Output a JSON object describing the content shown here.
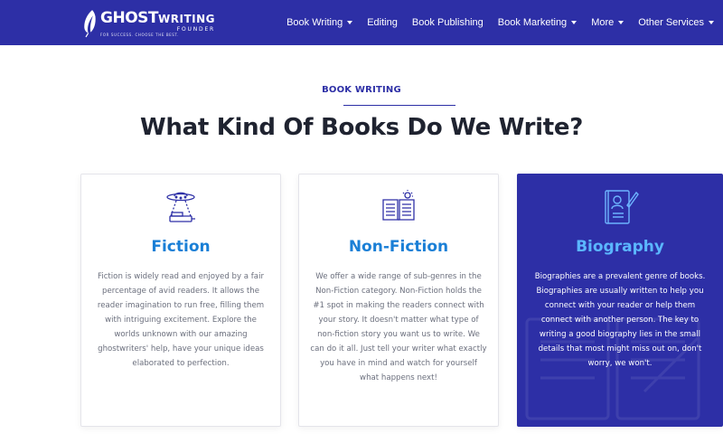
{
  "header": {
    "logo": {
      "main_text": "GHOST",
      "accent_text": "WRITING",
      "sub_text": "FOUNDER",
      "tagline": "FOR SUCCESS. CHOOSE THE BEST."
    },
    "nav": [
      {
        "label": "Book Writing",
        "has_dropdown": true
      },
      {
        "label": "Editing",
        "has_dropdown": false
      },
      {
        "label": "Book Publishing",
        "has_dropdown": false
      },
      {
        "label": "Book Marketing",
        "has_dropdown": true
      },
      {
        "label": "More",
        "has_dropdown": true
      },
      {
        "label": "Other Services",
        "has_dropdown": true
      }
    ]
  },
  "section": {
    "eyebrow": "BOOK WRITING",
    "heading": "What Kind Of Books Do We Write?"
  },
  "cards": [
    {
      "title": "Fiction",
      "icon": "ufo-book-icon",
      "body": "Fiction is widely read and enjoyed by a fair percentage of avid readers. It allows the reader imagination to run free, filling them with intriguing excitement. Explore the worlds unknown with our amazing ghostwriters' help, have your unique ideas elaborated to perfection."
    },
    {
      "title": "Non-Fiction",
      "icon": "open-book-icon",
      "body": "We offer a wide range of sub-genres in the Non-Fiction category. Non-Fiction holds the #1 spot in making the readers connect with your story. It doesn't matter what type of non-fiction story you want us to write. We can do it all. Just tell your writer what exactly you have in mind and watch for yourself what happens next!"
    },
    {
      "title": "Biography",
      "icon": "biography-book-icon",
      "body": "Biographies are a prevalent genre of books. Biographies are usually written to help you connect with your reader or help them connect with another person. The key to writing a good biography lies in the small details that most might miss out on, don't worry, we won't."
    }
  ],
  "colors": {
    "brand": "#2d2fa6",
    "title_blue": "#1a7fd6",
    "active_title": "#5bb6ff",
    "heading": "#1f2330"
  }
}
